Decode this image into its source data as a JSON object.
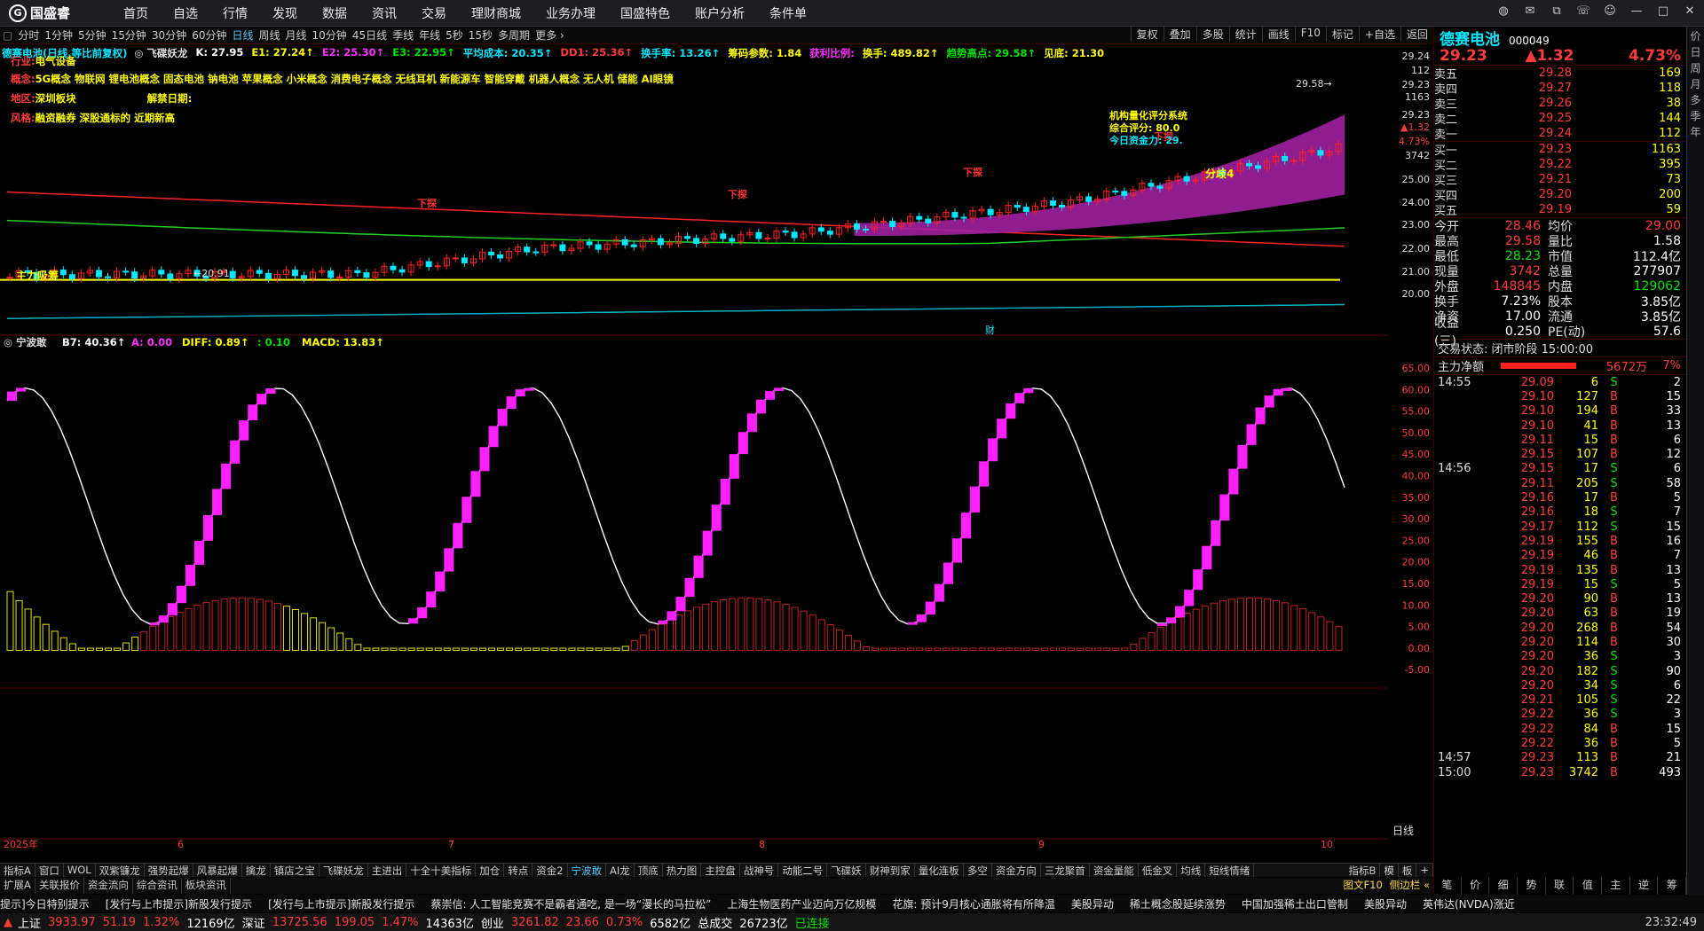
{
  "app": {
    "name": "国盛睿",
    "nav": [
      "首页",
      "自选",
      "行情",
      "发现",
      "数据",
      "资讯",
      "交易",
      "理财商城",
      "业务办理",
      "国盛特色",
      "账户分析",
      "条件单"
    ],
    "win_icons": [
      "chat-icon",
      "mail-icon",
      "link-icon",
      "phone-icon",
      "user-icon",
      "minimize-icon",
      "restore-icon",
      "close-icon"
    ]
  },
  "periods": [
    "分时",
    "1分钟",
    "5分钟",
    "15分钟",
    "30分钟",
    "60分钟",
    "日线",
    "周线",
    "月线",
    "10分钟",
    "45日线",
    "季线",
    "年线",
    "5秒",
    "15秒",
    "多周期",
    "更多 ›"
  ],
  "period_active": "日线",
  "period_right": [
    "复权",
    "叠加",
    "多股",
    "统计",
    "画线",
    "F10",
    "标记",
    "+自选",
    "返回"
  ],
  "info": {
    "stock": "德赛电池(日线,等比前复权)",
    "rest": [
      {
        "t": "◎ 飞碟妖龙",
        "c": "#ddd"
      },
      {
        "t": "K: 27.95",
        "c": "#fff"
      },
      {
        "t": "E1: 27.24↑",
        "c": "#ffff00"
      },
      {
        "t": "E2: 25.30↑",
        "c": "#ff30ff"
      },
      {
        "t": "E3: 22.95↑",
        "c": "#00e000"
      },
      {
        "t": "平均成本: 20.35↑",
        "c": "#00e8ff"
      },
      {
        "t": "DD1: 25.36↑",
        "c": "#ff3c3c"
      },
      {
        "t": "换手率: 13.26↑",
        "c": "#00e8ff"
      },
      {
        "t": "筹码参数: 1.84",
        "c": "#ffff00"
      },
      {
        "t": "获利比例:",
        "c": "#ff30ff"
      },
      {
        "t": "换手: 489.82↑",
        "c": "#ffff00"
      },
      {
        "t": "趋势高点: 29.58↑",
        "c": "#00e000"
      },
      {
        "t": "见底: 21.30",
        "c": "#ffff00"
      }
    ]
  },
  "profile": {
    "industry_label": "行业:",
    "industry": "电气设备",
    "concept_label": "概念:",
    "concepts": "5G概念 物联网 锂电池概念 固态电池 钠电池 苹果概念 小米概念 消费电子概念 无线耳机 新能源车 智能穿戴 机器人概念 无人机 储能 AI眼镜",
    "region_label": "地区:",
    "region": "深圳板块",
    "unlock_label": "解禁日期:",
    "style_label": "风格:",
    "style": "融资融券 深股通标的 近期新高"
  },
  "chart_labels": {
    "main_absorb": "主力吸筹",
    "low_price": "20.91",
    "high_price": "29.58",
    "xiatan": "下探",
    "sys": "机构量化评分系统",
    "score": "综合评分: 80.0",
    "power": "今日资金力: 29.",
    "div4": "分歧4",
    "cai": "财",
    "ind_name": "宁波敢",
    "ind_vals": [
      {
        "t": "B7: 40.36↑",
        "c": "#fff"
      },
      {
        "t": "A: 0.00",
        "c": "#ff30ff"
      },
      {
        "t": "DIFF: 0.89↑",
        "c": "#ffff00"
      },
      {
        "t": ": 0.10",
        "c": "#00e000"
      },
      {
        "t": "MACD: 13.83↑",
        "c": "#ffff00"
      }
    ]
  },
  "upper_axis": [
    "29.24",
    "112",
    "29.23",
    "1163",
    "29.23",
    "▲1.32",
    "4.73%",
    "3742",
    "25.00",
    "24.00",
    "23.00",
    "22.00",
    "21.00",
    "20.00"
  ],
  "lower_axis": [
    "65.00",
    "60.00",
    "55.00",
    "50.00",
    "45.00",
    "40.00",
    "35.00",
    "30.00",
    "25.00",
    "20.00",
    "15.00",
    "10.00",
    "5.00",
    "0.00",
    "-5.00"
  ],
  "x_axis": [
    "2025年",
    "6",
    "7",
    "8",
    "9",
    "10"
  ],
  "x_axis_right": "日线",
  "quote": {
    "name": "德赛电池",
    "code": "000049",
    "price": "29.23",
    "change": "▲1.32",
    "pct": "4.73%",
    "asks": [
      [
        "卖五",
        "29.28",
        "169"
      ],
      [
        "卖四",
        "29.27",
        "118"
      ],
      [
        "卖三",
        "29.26",
        "38"
      ],
      [
        "卖二",
        "29.25",
        "144"
      ],
      [
        "卖一",
        "29.24",
        "112"
      ]
    ],
    "bids": [
      [
        "买一",
        "29.23",
        "1163"
      ],
      [
        "买二",
        "29.22",
        "395"
      ],
      [
        "买三",
        "29.21",
        "73"
      ],
      [
        "买四",
        "29.20",
        "200"
      ],
      [
        "买五",
        "29.19",
        "59"
      ]
    ],
    "stats": [
      [
        "今开",
        "28.46",
        "均价",
        "29.00"
      ],
      [
        "最高",
        "29.58",
        "量比",
        "1.58"
      ],
      [
        "最低",
        "28.23",
        "市值",
        "112.4亿"
      ],
      [
        "现量",
        "3742",
        "总量",
        "277907"
      ],
      [
        "外盘",
        "148845",
        "内盘",
        "129062"
      ],
      [
        "换手",
        "7.23%",
        "股本",
        "3.85亿"
      ],
      [
        "净资",
        "17.00",
        "流通",
        "3.85亿"
      ],
      [
        "收益(三)",
        "0.250",
        "PE(动)",
        "57.6"
      ]
    ],
    "trade_state": "交易状态: 闭市阶段 15:00:00",
    "net_label": "主力净额",
    "net_val": "5672万",
    "net_pct": "7%",
    "ticks": [
      [
        "14:55",
        "29.09",
        "6",
        "S",
        "2"
      ],
      [
        "",
        "29.10",
        "127",
        "B",
        "15"
      ],
      [
        "",
        "29.10",
        "194",
        "B",
        "33"
      ],
      [
        "",
        "29.10",
        "41",
        "B",
        "13"
      ],
      [
        "",
        "29.11",
        "15",
        "B",
        "6"
      ],
      [
        "",
        "29.15",
        "107",
        "B",
        "12"
      ],
      [
        "14:56",
        "29.15",
        "17",
        "S",
        "6"
      ],
      [
        "",
        "29.11",
        "205",
        "S",
        "58"
      ],
      [
        "",
        "29.16",
        "17",
        "B",
        "5"
      ],
      [
        "",
        "29.16",
        "18",
        "S",
        "7"
      ],
      [
        "",
        "29.17",
        "112",
        "S",
        "15"
      ],
      [
        "",
        "29.19",
        "155",
        "B",
        "16"
      ],
      [
        "",
        "29.19",
        "46",
        "B",
        "7"
      ],
      [
        "",
        "29.19",
        "135",
        "B",
        "13"
      ],
      [
        "",
        "29.19",
        "15",
        "S",
        "5"
      ],
      [
        "",
        "29.20",
        "90",
        "B",
        "13"
      ],
      [
        "",
        "29.20",
        "63",
        "B",
        "19"
      ],
      [
        "",
        "29.20",
        "268",
        "B",
        "54"
      ],
      [
        "",
        "29.20",
        "114",
        "B",
        "30"
      ],
      [
        "",
        "29.20",
        "36",
        "S",
        "3"
      ],
      [
        "",
        "29.20",
        "182",
        "S",
        "90"
      ],
      [
        "",
        "29.20",
        "34",
        "S",
        "6"
      ],
      [
        "",
        "29.21",
        "105",
        "S",
        "22"
      ],
      [
        "",
        "29.22",
        "36",
        "S",
        "3"
      ],
      [
        "",
        "29.22",
        "84",
        "B",
        "15"
      ],
      [
        "",
        "29.22",
        "36",
        "B",
        "5"
      ],
      [
        "14:57",
        "29.23",
        "113",
        "B",
        "21"
      ],
      [
        "15:00",
        "29.23",
        "3742",
        "B",
        "493"
      ]
    ]
  },
  "side_tabs": [
    "价",
    "日",
    "周",
    "月",
    "多",
    "季",
    "年"
  ],
  "ind_tabs": [
    "指标A",
    "窗口",
    "WOL",
    "双紫镰龙",
    "强势起爆",
    "风暴起爆",
    "擒龙",
    "镇店之宝",
    "飞碟妖龙",
    "主进出",
    "十全十美指标",
    "加仓",
    "转点",
    "资金2",
    "宁波敢",
    "AI龙",
    "顶底",
    "热力图",
    "主控盘",
    "战神号",
    "动能二号",
    "飞碟妖",
    "财神到家",
    "量化连板",
    "多空",
    "资金方向",
    "三龙聚首",
    "资金量能",
    "低金叉",
    "均线",
    "短线情绪"
  ],
  "ind_tabs_right": [
    "指标B",
    "模",
    "板",
    "+"
  ],
  "sub_tabs": [
    "扩展A",
    "关联报价",
    "资金流向",
    "综合资讯",
    "板块资讯"
  ],
  "bottom_right_tabs": [
    "图文F10",
    "侧边栏 «"
  ],
  "tl_tabs": [
    "笔",
    "价",
    "细",
    "势",
    "联",
    "值",
    "主",
    "逆",
    "筹"
  ],
  "news": [
    "提示]今日特别提示",
    "[发行与上市提示]新股发行提示",
    "[发行与上市提示]新股发行提示",
    "蔡崇信: 人工智能竞赛不是霸者通吃, 是一场“漫长的马拉松”",
    "上海生物医药产业迈向万亿规模",
    "花旗: 预计9月核心通胀将有所降温",
    "美股异动",
    "稀土概念股延续涨势",
    "中国加强稀土出口管制",
    "美股异动",
    "英伟达(NVDA)涨近"
  ],
  "status": {
    "sh_label": "上证",
    "sh": "3933.97",
    "sh_c": "51.19",
    "sh_p": "1.32%",
    "sh_v": "12169亿",
    "sz_label": "深证",
    "sz": "13725.56",
    "sz_c": "199.05",
    "sz_p": "1.47%",
    "sz_v": "14363亿",
    "cy_label": "创业",
    "cy": "3261.82",
    "cy_c": "23.66",
    "cy_p": "0.73%",
    "cy_v": "6582亿",
    "total_label": "总成交",
    "total": "26723亿",
    "conn": "已连接",
    "time": "23:32:49"
  },
  "chart_data": {
    "type": "candlestick+histogram",
    "upper_ylim": [
      19.5,
      29.8
    ],
    "lower_ylim": [
      -7,
      68
    ],
    "lower_series": "B7 oscillator with pink blocks and yellow/red volume-style bars"
  }
}
